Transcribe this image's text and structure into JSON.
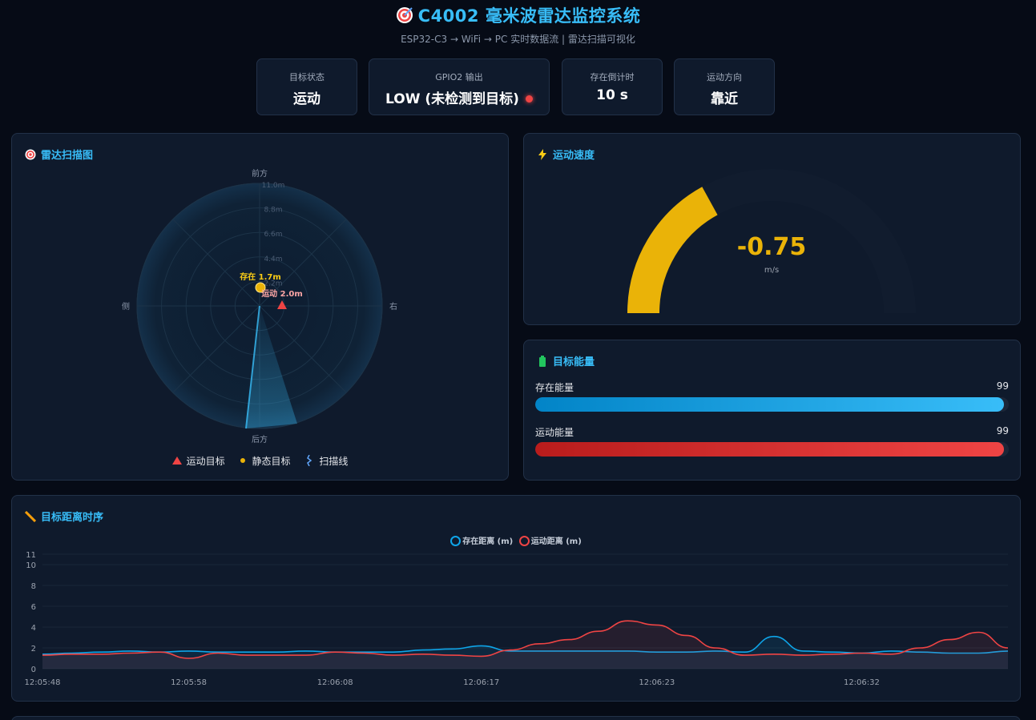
{
  "header": {
    "title": "C4002 毫米波雷达监控系统",
    "subtitle": "ESP32-C3 → WiFi → PC 实时数据流 | 雷达扫描可视化"
  },
  "stats": [
    {
      "label": "目标状态",
      "value": "运动"
    },
    {
      "label": "GPIO2 输出",
      "value": "LOW (未检测到目标)"
    },
    {
      "label": "存在倒计时",
      "value": "10 s"
    },
    {
      "label": "运动方向",
      "value": "靠近"
    }
  ],
  "radar": {
    "title": "雷达扫描图",
    "directions": {
      "front": "前方",
      "back": "后方",
      "left": "侧",
      "right": "右"
    },
    "ring_labels": [
      "11.0m",
      "8.8m",
      "6.6m",
      "4.4m",
      "2.2m"
    ],
    "max_range": 11.0,
    "presence_target": {
      "label": "存在 1.7m",
      "distance": 1.7
    },
    "motion_target": {
      "label": "运动 2.0m",
      "distance": 2.0
    },
    "legend": {
      "motion": "运动目标",
      "static": "静态目标",
      "scan": "扫描线"
    }
  },
  "speed": {
    "title": "运动速度",
    "value": "-0.75",
    "unit": "m/s",
    "gauge_fraction": 0.34
  },
  "energy": {
    "title": "目标能量",
    "presence_label": "存在能量",
    "presence_value": "99",
    "presence_fraction": 0.99,
    "motion_label": "运动能量",
    "motion_value": "99",
    "motion_fraction": 0.99
  },
  "timeseries": {
    "title": "目标距离时序"
  },
  "colors": {
    "accent": "#38bdf8",
    "motion": "#ef4444",
    "presence": "#0ea5e9",
    "static_target": "#eab308",
    "gauge": "#eab308"
  },
  "chart_data": {
    "type": "line",
    "x": [
      "12:05:48",
      "12:05:50",
      "12:05:52",
      "12:05:54",
      "12:05:56",
      "12:05:58",
      "12:06:00",
      "12:06:02",
      "12:06:04",
      "12:06:06",
      "12:06:08",
      "12:06:10",
      "12:06:12",
      "12:06:14",
      "12:06:15",
      "12:06:17",
      "12:06:18",
      "12:06:19",
      "12:06:20",
      "12:06:21",
      "12:06:22",
      "12:06:23",
      "12:06:25",
      "12:06:26",
      "12:06:27",
      "12:06:28",
      "12:06:30",
      "12:06:31",
      "12:06:32",
      "12:06:33",
      "12:06:34",
      "12:06:35",
      "12:06:36",
      "12:06:38"
    ],
    "x_tick_labels": [
      "12:05:48",
      "12:05:58",
      "12:06:08",
      "12:06:17",
      "12:06:23",
      "12:06:32"
    ],
    "y_ticks": [
      0,
      2,
      4,
      6,
      8,
      10,
      11
    ],
    "ylim": [
      0,
      11
    ],
    "series": [
      {
        "name": "存在距离 (m)",
        "values": [
          1.4,
          1.5,
          1.6,
          1.7,
          1.6,
          1.7,
          1.6,
          1.6,
          1.6,
          1.7,
          1.6,
          1.6,
          1.6,
          1.8,
          1.9,
          2.2,
          1.7,
          1.7,
          1.7,
          1.7,
          1.7,
          1.6,
          1.6,
          1.7,
          1.6,
          3.1,
          1.7,
          1.6,
          1.5,
          1.7,
          1.6,
          1.5,
          1.5,
          1.7
        ]
      },
      {
        "name": "运动距离 (m)",
        "values": [
          1.3,
          1.4,
          1.4,
          1.5,
          1.6,
          1.0,
          1.5,
          1.3,
          1.3,
          1.3,
          1.6,
          1.5,
          1.3,
          1.4,
          1.3,
          1.2,
          1.8,
          2.4,
          2.8,
          3.6,
          4.6,
          4.2,
          3.2,
          2.0,
          1.3,
          1.4,
          1.3,
          1.4,
          1.5,
          1.4,
          2.0,
          2.8,
          3.5,
          2.0
        ]
      }
    ],
    "legend_position": "top"
  }
}
